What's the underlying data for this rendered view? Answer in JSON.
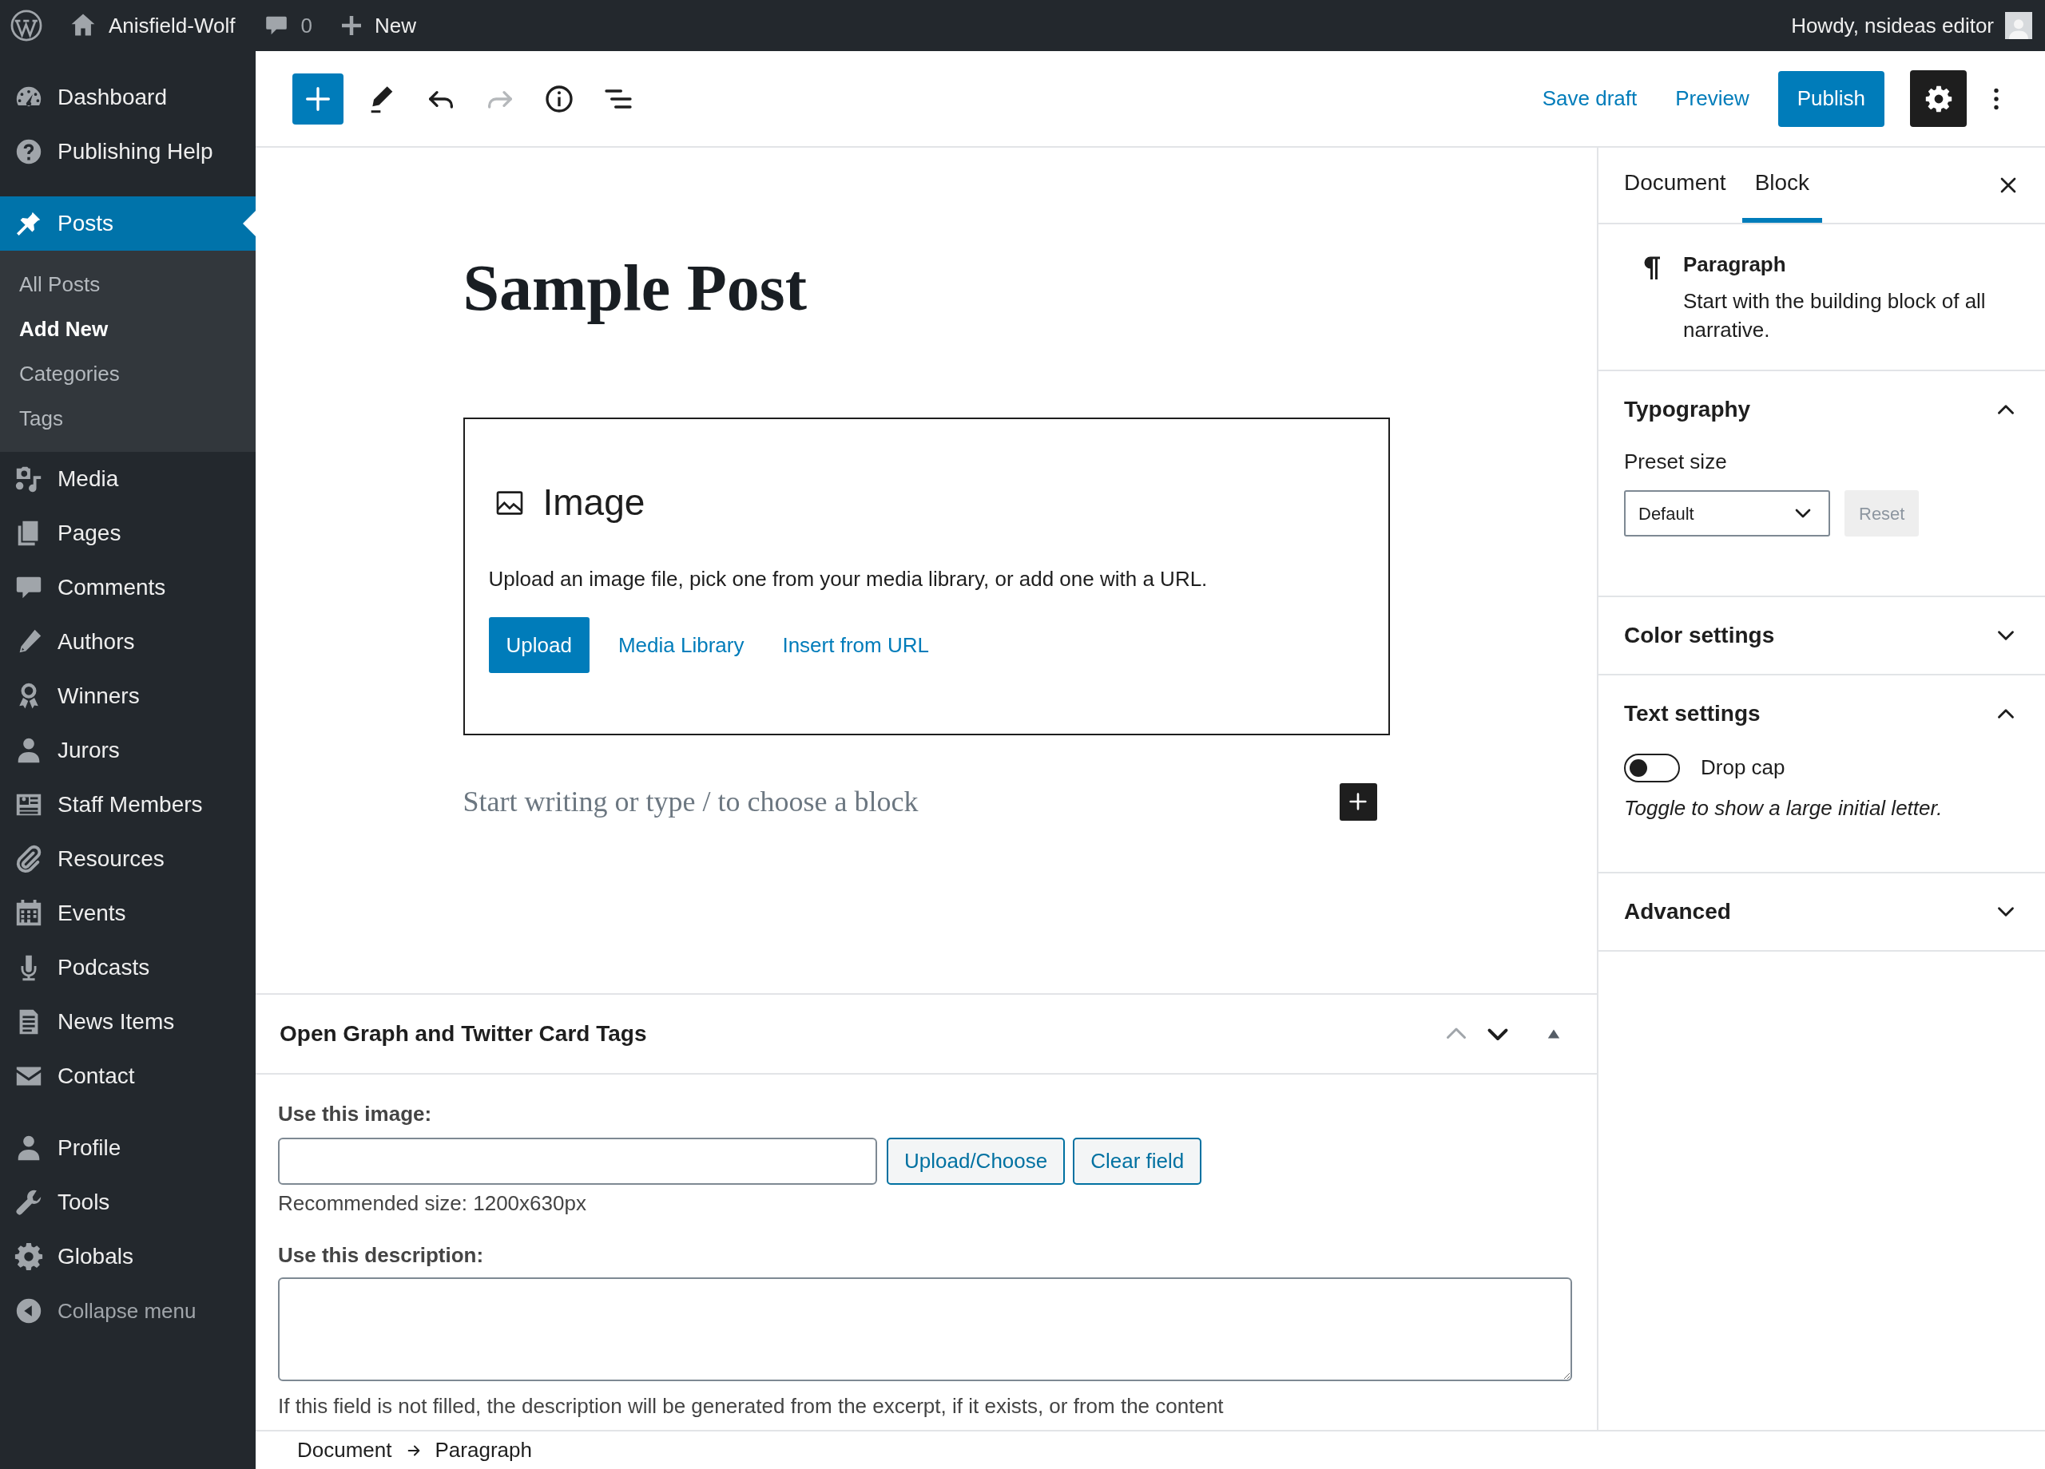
{
  "admin_bar": {
    "site_name": "Anisfield-Wolf",
    "comment_count": "0",
    "new_label": "New",
    "greeting": "Howdy, nsideas editor"
  },
  "sidebar": {
    "groups": [
      {
        "items": [
          {
            "label": "Dashboard",
            "selected": false
          },
          {
            "label": "Publishing Help",
            "selected": false
          }
        ]
      },
      {
        "items": [
          {
            "label": "Posts",
            "selected": true,
            "children": [
              {
                "label": "All Posts",
                "selected": false
              },
              {
                "label": "Add New",
                "selected": true
              },
              {
                "label": "Categories",
                "selected": false
              },
              {
                "label": "Tags",
                "selected": false
              }
            ]
          },
          {
            "label": "Media",
            "selected": false
          },
          {
            "label": "Pages",
            "selected": false
          },
          {
            "label": "Comments",
            "selected": false
          },
          {
            "label": "Authors",
            "selected": false
          },
          {
            "label": "Winners",
            "selected": false
          },
          {
            "label": "Jurors",
            "selected": false
          },
          {
            "label": "Staff Members",
            "selected": false
          },
          {
            "label": "Resources",
            "selected": false
          },
          {
            "label": "Events",
            "selected": false
          },
          {
            "label": "Podcasts",
            "selected": false
          },
          {
            "label": "News Items",
            "selected": false
          },
          {
            "label": "Contact",
            "selected": false
          }
        ]
      },
      {
        "items": [
          {
            "label": "Profile",
            "selected": false
          },
          {
            "label": "Tools",
            "selected": false
          },
          {
            "label": "Globals",
            "selected": false
          }
        ]
      }
    ],
    "collapse_label": "Collapse menu"
  },
  "header": {
    "redo_disabled": true,
    "save_draft": "Save draft",
    "preview": "Preview",
    "publish": "Publish",
    "settings_active": true
  },
  "post": {
    "title": "Sample Post",
    "image_block": {
      "title": "Image",
      "instructions": "Upload an image file, pick one from your media library, or add one with a URL.",
      "upload": "Upload",
      "media_library": "Media Library",
      "insert_url": "Insert from URL"
    },
    "appender_placeholder": "Start writing or type / to choose a block"
  },
  "meta_box": {
    "title": "Open Graph and Twitter Card Tags",
    "expanded": true,
    "image_label": "Use this image:",
    "upload_button": "Upload/Choose",
    "clear_button": "Clear field",
    "image_hint": "Recommended size: 1200x630px",
    "description_label": "Use this description:",
    "description_help": "If this field is not filled, the description will be generated from the excerpt, if it exists, or from the content"
  },
  "settings": {
    "tabs": [
      {
        "label": "Document",
        "selected": false
      },
      {
        "label": "Block",
        "selected": true
      }
    ],
    "block_card": {
      "title": "Paragraph",
      "description": "Start with the building block of all narrative."
    },
    "panels": [
      {
        "title": "Typography",
        "expanded": true,
        "preset_label": "Preset size",
        "select_value": "Default",
        "reset_label": "Reset",
        "reset_disabled": true
      },
      {
        "title": "Color settings",
        "expanded": false
      },
      {
        "title": "Text settings",
        "expanded": true,
        "toggle_label": "Drop cap",
        "toggle_on": false,
        "help": "Toggle to show a large initial letter."
      },
      {
        "title": "Advanced",
        "expanded": false
      }
    ]
  },
  "breadcrumb": [
    "Document",
    "Paragraph"
  ]
}
